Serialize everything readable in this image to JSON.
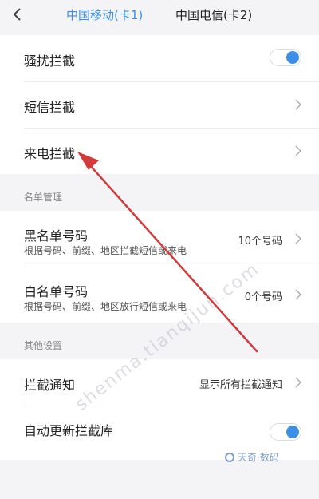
{
  "header": {
    "tabs": [
      {
        "label": "中国移动(卡1)",
        "active": true
      },
      {
        "label": "中国电信(卡2)",
        "active": false
      }
    ]
  },
  "block_settings": {
    "items": [
      {
        "label": "骚扰拦截",
        "control": "toggle",
        "on": true
      },
      {
        "label": "短信拦截",
        "control": "chevron"
      },
      {
        "label": "来电拦截",
        "control": "chevron"
      }
    ]
  },
  "list_management": {
    "title": "名单管理",
    "items": [
      {
        "label": "黑名单号码",
        "sub": "根据号码、前缀、地区拦截短信或来电",
        "value": "10个号码"
      },
      {
        "label": "白名单号码",
        "sub": "根据号码、前缀、地区放行短信或来电",
        "value": "0个号码"
      }
    ]
  },
  "other_settings": {
    "title": "其他设置",
    "items": [
      {
        "label": "拦截通知",
        "value": "显示所有拦截通知",
        "control": "chevron"
      },
      {
        "label": "自动更新拦截库",
        "control": "toggle",
        "on": true
      }
    ]
  },
  "watermark": {
    "text": "shenma.tianqijun.com",
    "logo": "天奇·数码"
  },
  "colors": {
    "accent": "#3d8fe6",
    "annotation_arrow": "#d23b3b"
  }
}
